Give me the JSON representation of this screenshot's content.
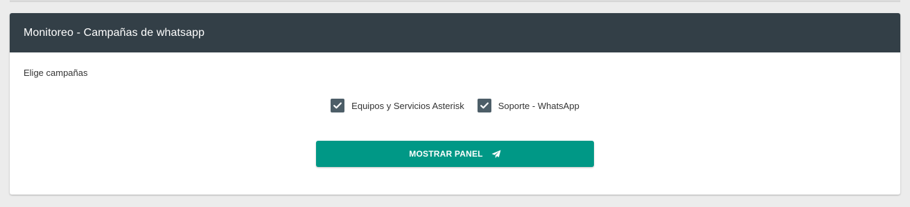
{
  "panel": {
    "title": "Monitoreo - Campañas de whatsapp",
    "header_color": "#333f47"
  },
  "form": {
    "choose_label": "Elige campañas",
    "campaigns": [
      {
        "label": "Equipos y Servicios Asterisk",
        "checked": true
      },
      {
        "label": "Soporte - WhatsApp",
        "checked": true
      }
    ],
    "checkbox_color": "#4d5e68",
    "check_icon": "check-icon"
  },
  "action": {
    "label": "MOSTRAR PANEL",
    "icon": "paper-plane-icon",
    "color": "#009886"
  }
}
